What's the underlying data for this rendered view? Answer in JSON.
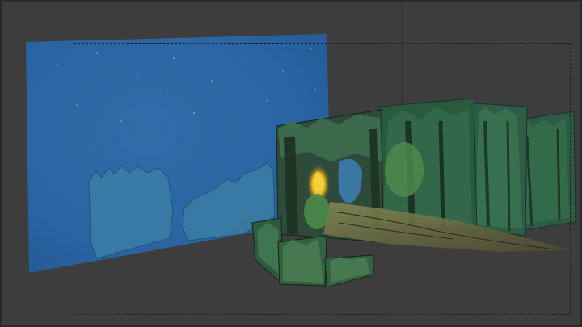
{
  "viewport": {
    "mode": "3D viewport",
    "background_color": "#3d3d3d",
    "camera_frame": "dashed-outline"
  },
  "layers": [
    {
      "name": "sky-plane",
      "description": "",
      "color": "#2f7fc0"
    },
    {
      "name": "forest-plane-front",
      "color": "#2d4a3a"
    },
    {
      "name": "forest-plane-mid",
      "color": "#2a5a3c"
    },
    {
      "name": "forest-plane-back-1",
      "color": "#2f5c47"
    },
    {
      "name": "forest-plane-back-2",
      "color": "#2d5a45"
    }
  ],
  "icons": {
    "lantern": "lantern-glow-icon"
  }
}
